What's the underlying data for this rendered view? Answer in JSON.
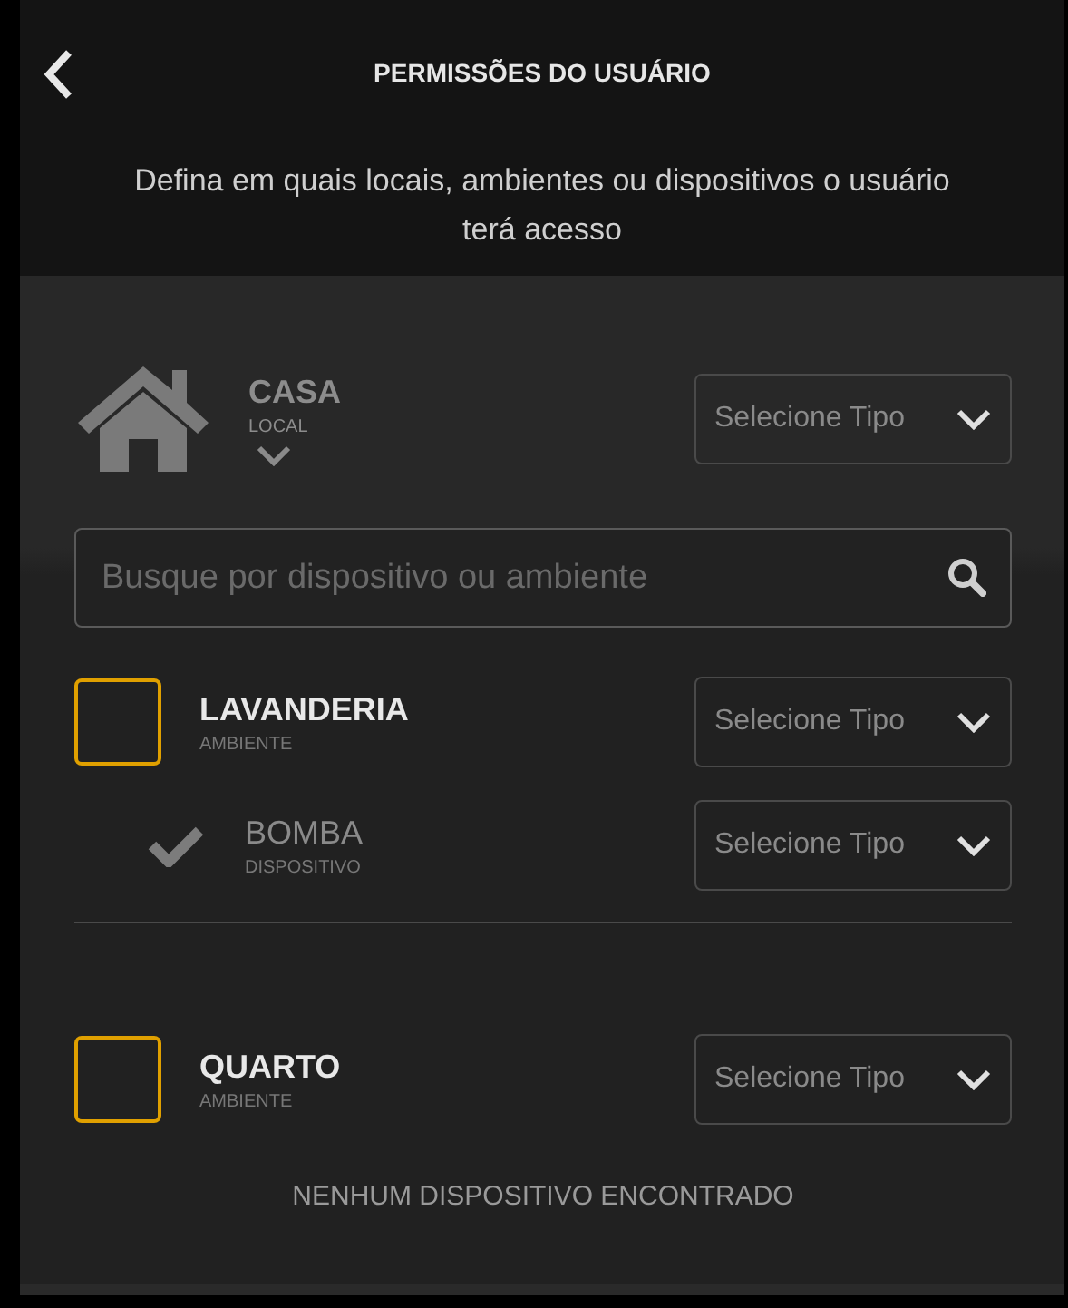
{
  "header": {
    "title": "PERMISSÕES DO USUÁRIO",
    "subtitle": "Defina em quais locais, ambientes ou dispositivos o usuário terá acesso"
  },
  "location": {
    "name": "CASA",
    "type": "LOCAL",
    "select": {
      "placeholder": "Selecione Tipo"
    }
  },
  "search": {
    "placeholder": "Busque por dispositivo ou ambiente"
  },
  "rooms": [
    {
      "name": "LAVANDERIA",
      "type": "AMBIENTE",
      "checked": false,
      "select": {
        "placeholder": "Selecione Tipo"
      },
      "children": [
        {
          "name": "BOMBA",
          "type": "DISPOSITIVO",
          "checked": true,
          "select": {
            "placeholder": "Selecione Tipo"
          }
        }
      ]
    },
    {
      "name": "QUARTO",
      "type": "AMBIENTE",
      "checked": false,
      "select": {
        "placeholder": "Selecione Tipo"
      },
      "empty_message": "NENHUM DISPOSITIVO ENCONTRADO"
    }
  ]
}
